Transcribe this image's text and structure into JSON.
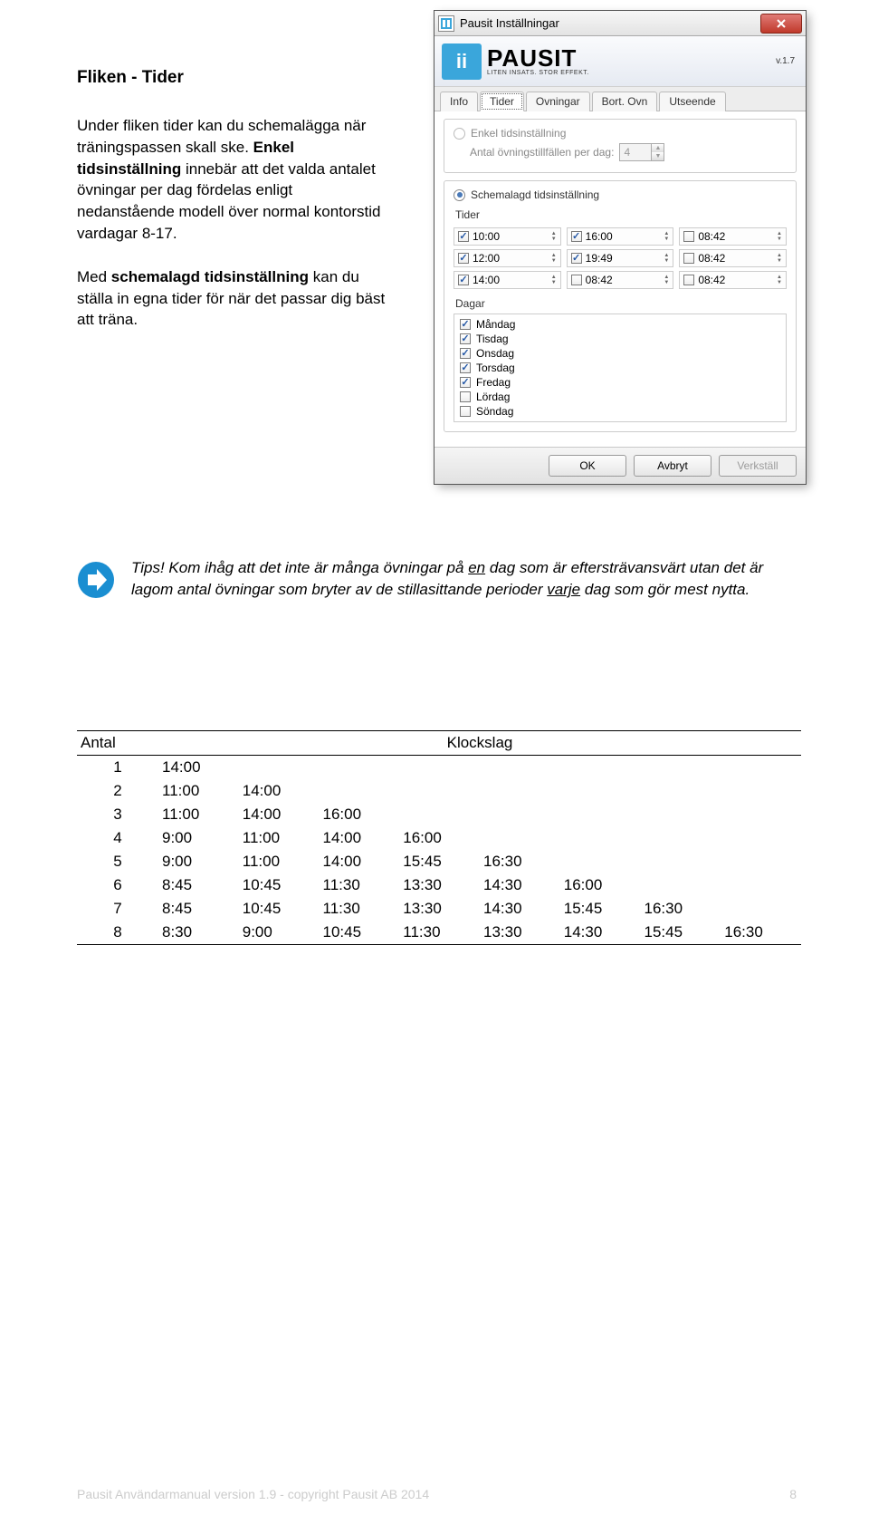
{
  "heading": "Fliken - Tider",
  "p1a": "Under fliken tider kan du schemalägga när träningspassen skall ske. ",
  "p1b_strong": "Enkel tidsinställning",
  "p1c": " innebär att det valda antalet övningar per dag fördelas enligt nedanstående modell över normal kontorstid vardagar 8-17.",
  "p2a": "Med ",
  "p2b_strong": "schemalagd tidsinställning",
  "p2c": " kan du ställa in egna tider för när det passar dig bäst att träna.",
  "tips1": "Tips! Kom ihåg att det inte är många övningar på ",
  "tips_u1": "en",
  "tips2": " dag som är eftersträvansvärt utan det är lagom antal övningar som bryter av de stillasittande perioder ",
  "tips_u2": "varje",
  "tips3": " dag som gör mest nytta.",
  "table": {
    "h1": "Antal",
    "h2": "Klockslag",
    "rows": [
      [
        "1",
        "14:00",
        "",
        "",
        "",
        "",
        "",
        "",
        ""
      ],
      [
        "2",
        "11:00",
        "14:00",
        "",
        "",
        "",
        "",
        "",
        ""
      ],
      [
        "3",
        "11:00",
        "14:00",
        "16:00",
        "",
        "",
        "",
        "",
        ""
      ],
      [
        "4",
        "9:00",
        "11:00",
        "14:00",
        "16:00",
        "",
        "",
        "",
        ""
      ],
      [
        "5",
        "9:00",
        "11:00",
        "14:00",
        "15:45",
        "16:30",
        "",
        "",
        ""
      ],
      [
        "6",
        "8:45",
        "10:45",
        "11:30",
        "13:30",
        "14:30",
        "16:00",
        "",
        ""
      ],
      [
        "7",
        "8:45",
        "10:45",
        "11:30",
        "13:30",
        "14:30",
        "15:45",
        "16:30",
        ""
      ],
      [
        "8",
        "8:30",
        "9:00",
        "10:45",
        "11:30",
        "13:30",
        "14:30",
        "15:45",
        "16:30"
      ]
    ]
  },
  "footer_left": "Pausit Användarmanual version 1.9  - copyright Pausit AB 2014",
  "footer_right": "8",
  "window": {
    "title": "Pausit Inställningar",
    "logo_main": "PAUSIT",
    "logo_sub": "LITEN INSATS. STOR EFFEKT.",
    "version": "v.1.7",
    "tabs": [
      "Info",
      "Tider",
      "Ovningar",
      "Bort. Ovn",
      "Utseende"
    ],
    "simple_radio": "Enkel tidsinställning",
    "simple_count_label": "Antal övningstillfällen per dag:",
    "simple_count_value": "4",
    "sched_radio": "Schemalagd tidsinställning",
    "tider_label": "Tider",
    "times": [
      {
        "on": true,
        "t": "10:00"
      },
      {
        "on": true,
        "t": "16:00"
      },
      {
        "on": false,
        "t": "08:42"
      },
      {
        "on": true,
        "t": "12:00"
      },
      {
        "on": true,
        "t": "19:49"
      },
      {
        "on": false,
        "t": "08:42"
      },
      {
        "on": true,
        "t": "14:00"
      },
      {
        "on": false,
        "t": "08:42"
      },
      {
        "on": false,
        "t": "08:42"
      }
    ],
    "dagar_label": "Dagar",
    "days": [
      {
        "on": true,
        "name": "Måndag"
      },
      {
        "on": true,
        "name": "Tisdag"
      },
      {
        "on": true,
        "name": "Onsdag"
      },
      {
        "on": true,
        "name": "Torsdag"
      },
      {
        "on": true,
        "name": "Fredag"
      },
      {
        "on": false,
        "name": "Lördag"
      },
      {
        "on": false,
        "name": "Söndag"
      }
    ],
    "ok": "OK",
    "cancel": "Avbryt",
    "apply": "Verkställ"
  }
}
